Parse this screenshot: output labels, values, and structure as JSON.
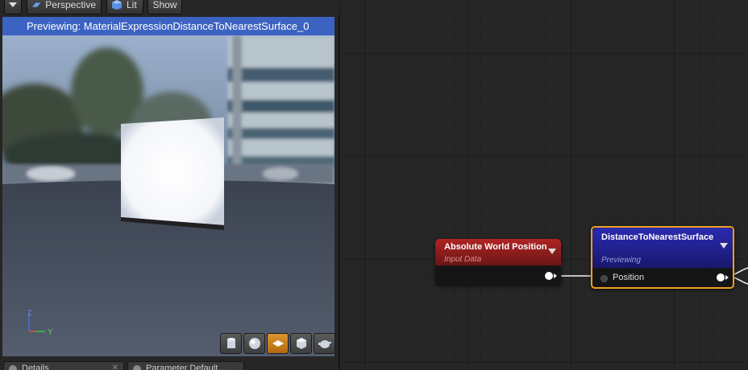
{
  "toolbar": {
    "perspective_label": "Perspective",
    "lit_label": "Lit",
    "show_label": "Show"
  },
  "viewport": {
    "preview_banner": "Previewing: MaterialExpressionDistanceToNearestSurface_0",
    "axis": {
      "z_label": "Z",
      "y_label": "Y"
    },
    "tools": [
      "cylinder-icon",
      "sphere-icon",
      "plane-icon",
      "cube-icon",
      "teapot-icon"
    ],
    "active_tool_index": 2
  },
  "tabs": {
    "details": "Details",
    "params": "Parameter Default..."
  },
  "graph": {
    "node_awp": {
      "title": "Absolute World Position",
      "subtitle": "Input Data"
    },
    "node_dns": {
      "title": "DistanceToNearestSurface",
      "subtitle": "Previewing",
      "input_label": "Position"
    }
  },
  "colors": {
    "banner": "#3d63c2",
    "node_awp_header": "#b02424",
    "node_dns_header": "#2a2ab0",
    "selection_outline": "#f0a020",
    "active_tool": "#d99530"
  }
}
